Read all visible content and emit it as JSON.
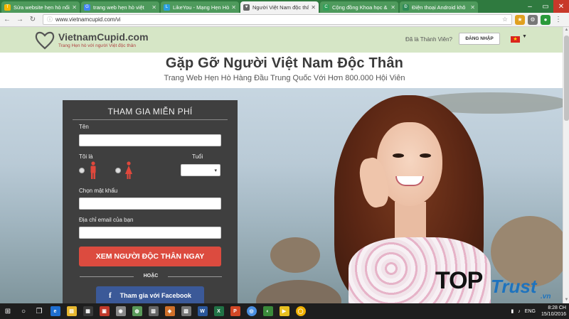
{
  "browser": {
    "tabs": [
      {
        "label": "Sửa website hẹn hò nổi",
        "icon": "T",
        "color": "#f5b800",
        "active": false
      },
      {
        "label": "trang web hẹn hò việt",
        "icon": "G",
        "color": "#4285f4",
        "active": false
      },
      {
        "label": "LikeYou - Mạng Hẹn Hò",
        "icon": "L",
        "color": "#2aa0e0",
        "active": false
      },
      {
        "label": "Người Việt Nam độc thâ",
        "icon": "♥",
        "color": "#666666",
        "active": true
      },
      {
        "label": "Cộng đồng Khoa học &",
        "icon": "C",
        "color": "#33a05a",
        "active": false
      },
      {
        "label": "Điện thoại Android khô",
        "icon": "Đ",
        "color": "#2e8b57",
        "active": false
      }
    ],
    "url_scheme": "ⓘ",
    "url": "www.vietnamcupid.com/vi"
  },
  "site": {
    "brand_name": "VietnamCupid.com",
    "tagline": "Trang Hẹn hò với người Việt độc thân",
    "member_question": "Đã là Thành Viên?",
    "login_label": "ĐĂNG NHẬP",
    "flag_glyph": "★"
  },
  "hero": {
    "title": "Gặp Gỡ Người Việt Nam Độc Thân",
    "subtitle": "Trang Web Hẹn Hò Hàng Đầu Trung Quốc Với Hơn 800.000 Hội Viên"
  },
  "signup": {
    "title": "THAM GIA MIỄN PHÍ",
    "name_label": "Tên",
    "i_am_label": "Tôi là",
    "age_label": "Tuổi",
    "password_label": "Chọn mật khẩu",
    "email_label": "Địa chỉ email của bạn",
    "cta_label": "XEM NGƯỜI ĐỘC THÂN NGAY",
    "or_label": "HOẶC",
    "facebook_label": "Tham gia với Facebook",
    "facebook_glyph": "f"
  },
  "watermark": {
    "top": "TOP",
    "trust": "Trust",
    "vn": ".vn"
  },
  "taskbar": {
    "language": "ENG",
    "time": "8:28 CH",
    "date": "15/10/2016"
  }
}
